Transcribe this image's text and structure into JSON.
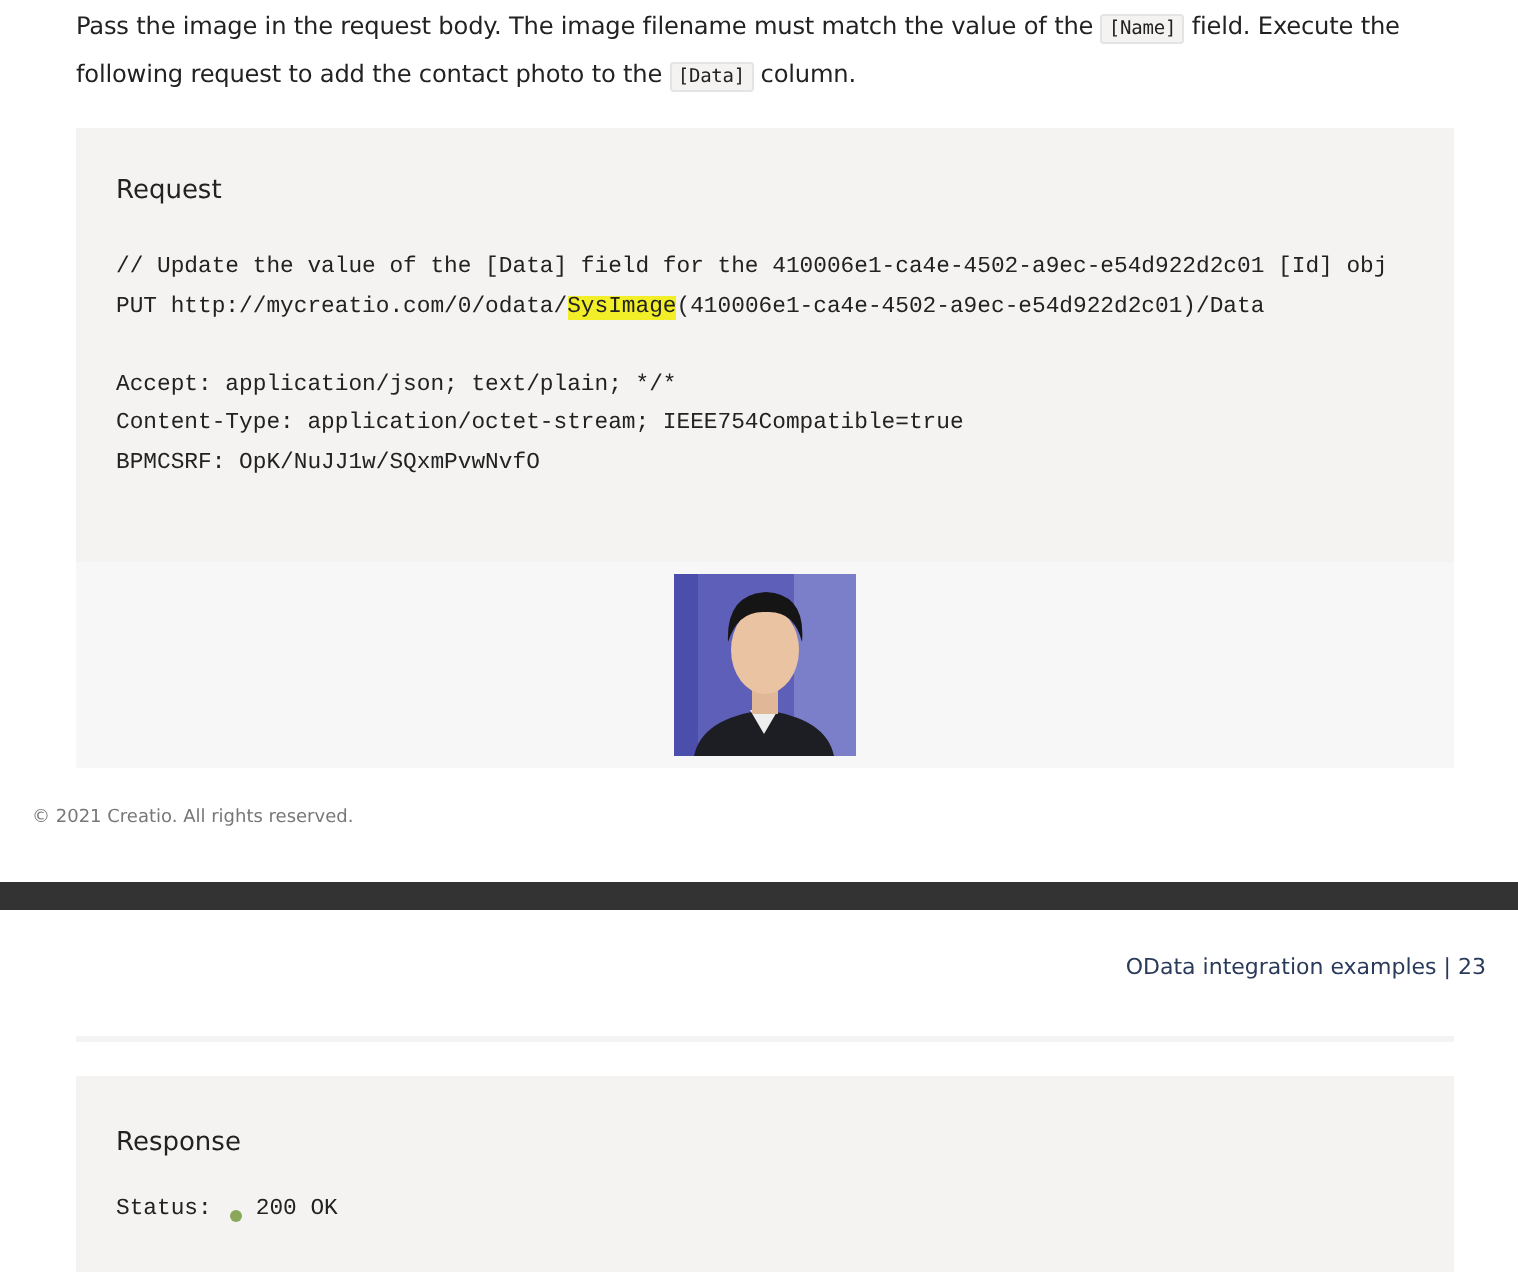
{
  "intro": {
    "parts": [
      {
        "kind": "text",
        "text": "Pass the image in the request body. The image filename must match the value of the "
      },
      {
        "kind": "code",
        "text": "[Name]"
      },
      {
        "kind": "text",
        "text": " field. Execute the following request to add the contact photo to the "
      },
      {
        "kind": "code",
        "text": "[Data]"
      },
      {
        "kind": "text",
        "text": " column."
      }
    ]
  },
  "request": {
    "title": "Request",
    "blocks": [
      [
        [
          {
            "text": "// Update the value of the [Data] field for the 410006e1-ca4e-4502-a9ec-e54d922d2c01 [Id] obj",
            "highlighted": false
          }
        ],
        [
          {
            "text": "PUT http://mycreatio.com/0/odata/",
            "highlighted": false
          },
          {
            "text": "SysImage",
            "highlighted": true
          },
          {
            "text": "(410006e1-ca4e-4502-a9ec-e54d922d2c01)/Data",
            "highlighted": false
          }
        ]
      ],
      [
        [
          {
            "text": "Accept: application/json; text/plain; */*",
            "highlighted": false
          }
        ],
        [
          {
            "text": "Content-Type: application/octet-stream; IEEE754Compatible=true",
            "highlighted": false
          }
        ],
        [
          {
            "text": "BPMCSRF: OpK/NuJJ1w/SQxmPvwNvfO",
            "highlighted": false
          }
        ]
      ]
    ],
    "photo": {
      "kind": "picture"
    }
  },
  "footer": "© 2021 Creatio. All rights reserved.",
  "page_header": "OData integration examples | 23",
  "response": {
    "title": "Response",
    "status_label": "Status:",
    "status_dot": {
      "color": "#8aa85a"
    },
    "status": "200 OK"
  }
}
